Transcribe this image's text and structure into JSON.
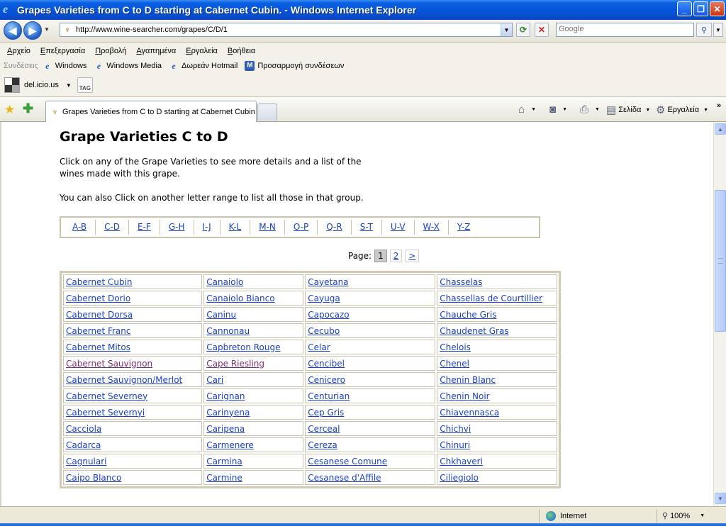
{
  "window": {
    "title": "Grapes Varieties from C to D starting at Cabernet Cubin. - Windows Internet Explorer"
  },
  "address": {
    "url": "http://www.wine-searcher.com/grapes/C/D/1",
    "search_placeholder": "Google"
  },
  "menu": [
    "Αρχείο",
    "Επεξεργασία",
    "Προβολή",
    "Αγαπημένα",
    "Εργαλεία",
    "Βοήθεια"
  ],
  "links_bar": {
    "label": "Συνδέσεις",
    "items": [
      "Windows",
      "Windows Media",
      "Δωρεάν Hotmail",
      "Προσαρμογή συνδέσεων"
    ]
  },
  "delicious": {
    "label": "del.icio.us",
    "tag_label": "TAG"
  },
  "tab": {
    "title": "Grapes Varieties from C to D starting at Cabernet Cubin."
  },
  "commands": {
    "page": "Σελίδα",
    "tools": "Εργαλεία"
  },
  "content": {
    "heading": "Grape Varieties C to D",
    "intro1": "Click on any of the Grape Varieties to see more details and a list of the wines made with this grape.",
    "intro2": "You can also Click on another letter range to list all those in that group.",
    "ranges": [
      "A-B",
      "C-D",
      "E-F",
      "G-H",
      "I-J",
      "K-L",
      "M-N",
      "O-P",
      "Q-R",
      "S-T",
      "U-V",
      "W-X",
      "Y-Z"
    ],
    "pager": {
      "label": "Page:",
      "current": "1",
      "next_page": "2",
      "next": ">"
    },
    "grapes": [
      [
        "Cabernet Cubin",
        "Canaiolo",
        "Cayetana",
        "Chasselas"
      ],
      [
        "Cabernet Dorio",
        "Canaiolo Bianco",
        "Cayuga",
        "Chassellas de Courtillier"
      ],
      [
        "Cabernet Dorsa",
        "Caninu",
        "Capocazo",
        "Chauche Gris"
      ],
      [
        "Cabernet Franc",
        "Cannonau",
        "Cecubo",
        "Chaudenet Gras"
      ],
      [
        "Cabernet Mitos",
        "Capbreton Rouge",
        "Celar",
        "Chelois"
      ],
      [
        "Cabernet Sauvignon",
        "Cape Riesling",
        "Cencibel",
        "Chenel"
      ],
      [
        "Cabernet Sauvignon/Merlot",
        "Cari",
        "Cenicero",
        "Chenin Blanc"
      ],
      [
        "Cabernet Severney",
        "Carignan",
        "Centurian",
        "Chenin Noir"
      ],
      [
        "Cabernet Severnyi",
        "Carinyena",
        "Cep Gris",
        "Chiavennasca"
      ],
      [
        "Cacciola",
        "Caripena",
        "Cerceal",
        "Chichvi"
      ],
      [
        "Cadarca",
        "Carmenere",
        "Cereza",
        "Chinuri"
      ],
      [
        "Cagnulari",
        "Carmina",
        "Cesanese Comune",
        "Chkhaveri"
      ],
      [
        "Caipo Blanco",
        "Carmine",
        "Cesanese d'Affile",
        "Ciliegiolo"
      ]
    ]
  },
  "status": {
    "zone": "Internet",
    "zoom": "100%"
  }
}
